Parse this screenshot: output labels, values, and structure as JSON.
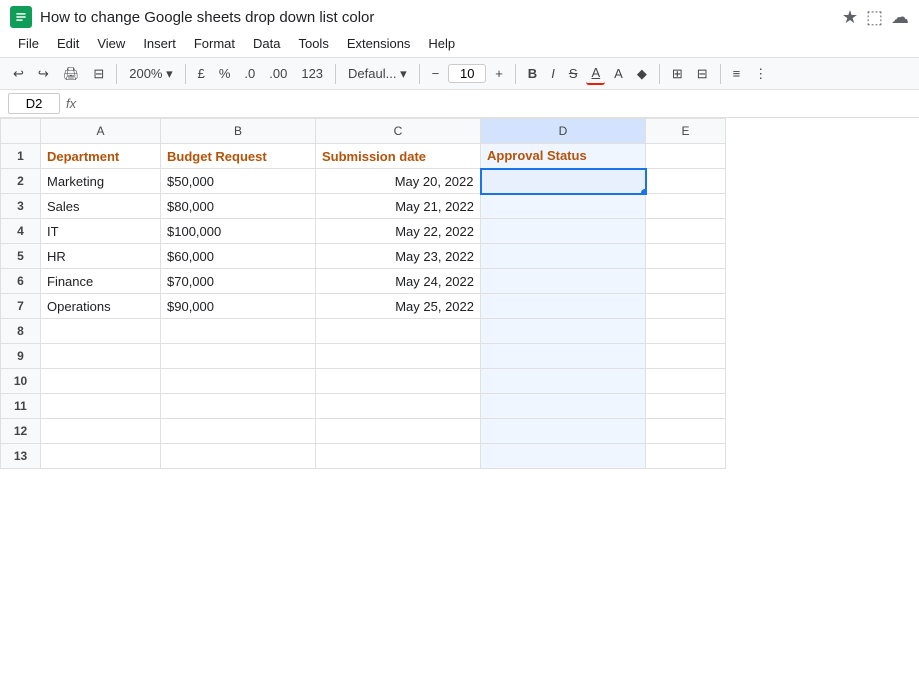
{
  "titleBar": {
    "title": "How to change Google sheets drop down list color",
    "starIcon": "★",
    "folderIcon": "⬚",
    "cloudIcon": "☁"
  },
  "menuBar": {
    "items": [
      "File",
      "Edit",
      "View",
      "Insert",
      "Format",
      "Data",
      "Tools",
      "Extensions",
      "Help"
    ]
  },
  "toolbar": {
    "undo": "↩",
    "redo": "↪",
    "print": "🖨",
    "paintFormat": "⊟",
    "zoom": "200%",
    "currency": "£",
    "percent": "%",
    "decIncrease": ".0",
    "decFixed": ".00",
    "number123": "123",
    "fontDefault": "Defaul...",
    "minus": "−",
    "fontSize": "10",
    "plus": "+",
    "bold": "B",
    "italic": "I",
    "strikethrough": "S̶",
    "underline": "A",
    "textColor": "A",
    "fillColor": "⬡",
    "borders": "⊞",
    "merge": "⊟",
    "align": "≡",
    "more": "⋮"
  },
  "formulaBar": {
    "cellRef": "D2",
    "fxLabel": "fx"
  },
  "columns": {
    "headers": [
      "",
      "A",
      "B",
      "C",
      "D",
      "E"
    ],
    "widths": [
      40,
      120,
      155,
      165,
      165,
      80
    ]
  },
  "rows": [
    {
      "num": "1",
      "cells": [
        "Department",
        "Budget Request",
        "Submission date",
        "Approval Status",
        ""
      ]
    },
    {
      "num": "2",
      "cells": [
        "Marketing",
        "$50,000",
        "May 20, 2022",
        "",
        ""
      ]
    },
    {
      "num": "3",
      "cells": [
        "Sales",
        "$80,000",
        "May 21, 2022",
        "",
        ""
      ]
    },
    {
      "num": "4",
      "cells": [
        "IT",
        "$100,000",
        "May 22, 2022",
        "",
        ""
      ]
    },
    {
      "num": "5",
      "cells": [
        "HR",
        "$60,000",
        "May 23, 2022",
        "",
        ""
      ]
    },
    {
      "num": "6",
      "cells": [
        "Finance",
        "$70,000",
        "May 24, 2022",
        "",
        ""
      ]
    },
    {
      "num": "7",
      "cells": [
        "Operations",
        "$90,000",
        "May 25, 2022",
        "",
        ""
      ]
    },
    {
      "num": "8",
      "cells": [
        "",
        "",
        "",
        "",
        ""
      ]
    },
    {
      "num": "9",
      "cells": [
        "",
        "",
        "",
        "",
        ""
      ]
    },
    {
      "num": "10",
      "cells": [
        "",
        "",
        "",
        "",
        ""
      ]
    },
    {
      "num": "11",
      "cells": [
        "",
        "",
        "",
        "",
        ""
      ]
    },
    {
      "num": "12",
      "cells": [
        "",
        "",
        "",
        "",
        ""
      ]
    },
    {
      "num": "13",
      "cells": [
        "",
        "",
        "",
        "",
        ""
      ]
    }
  ],
  "colors": {
    "headerText": "#b45309",
    "selectedBorder": "#1a73e8",
    "activeColBg": "#d3e3fd",
    "sheetBg": "#f8f9fa"
  }
}
